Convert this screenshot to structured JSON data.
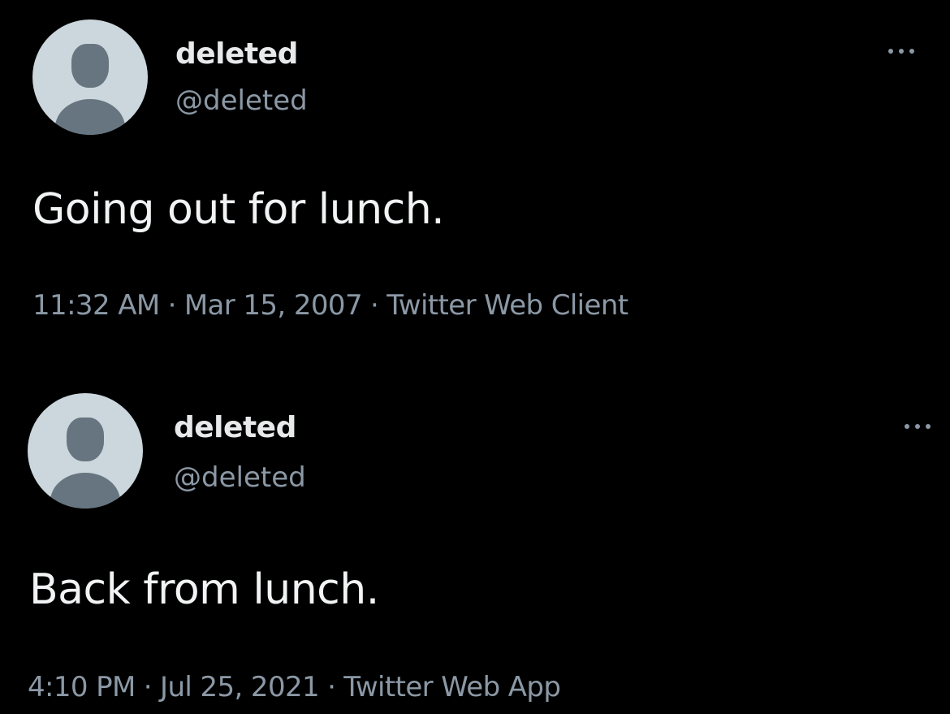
{
  "tweets": [
    {
      "display_name": "deleted",
      "handle": "@deleted",
      "text": "Going out for lunch.",
      "time": "11:32 AM",
      "date": "Mar 15, 2007",
      "source": "Twitter Web Client",
      "separator": "·",
      "more_icon": "more-horizontal-icon",
      "avatar_icon": "default-profile-icon"
    },
    {
      "display_name": "deleted",
      "handle": "@deleted",
      "text": "Back from lunch.",
      "time": "4:10 PM",
      "date": "Jul 25, 2021",
      "source": "Twitter Web App",
      "separator": "·",
      "more_icon": "more-horizontal-icon",
      "avatar_icon": "default-profile-icon"
    }
  ],
  "colors": {
    "background": "#000000",
    "primary_text": "#e7e9ea",
    "secondary_text": "#8b98a5",
    "avatar_bg": "#ccd6dd",
    "avatar_fg": "#66757f"
  }
}
